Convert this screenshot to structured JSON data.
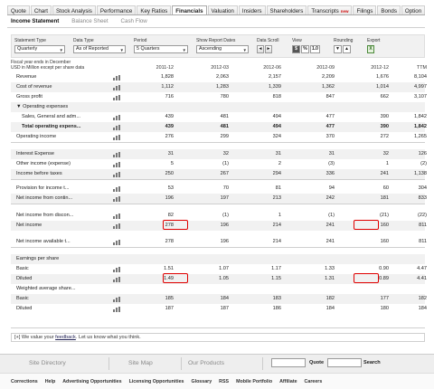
{
  "nav": {
    "tabs": [
      {
        "label": "Quote"
      },
      {
        "label": "Chart"
      },
      {
        "label": "Stock Analysis"
      },
      {
        "label": "Performance"
      },
      {
        "label": "Key Ratios"
      },
      {
        "label": "Financials"
      },
      {
        "label": "Valuation"
      },
      {
        "label": "Insiders"
      },
      {
        "label": "Shareholders"
      },
      {
        "label": "Transcripts",
        "badge": "new"
      },
      {
        "label": "Filings"
      },
      {
        "label": "Bonds"
      },
      {
        "label": "Option"
      }
    ],
    "active_tab": "Financials"
  },
  "subnav": {
    "items": [
      "Income Statement",
      "Balance Sheet",
      "Cash Flow"
    ],
    "active": "Income Statement"
  },
  "controls": {
    "statement_type": {
      "label": "Statement Type",
      "value": "Quarterly"
    },
    "data_type": {
      "label": "Data Type",
      "value": "As of Reported"
    },
    "period": {
      "label": "Period",
      "value": "5 Quarters"
    },
    "show_report_dates": {
      "label": "Show Report Dates",
      "value": "Ascending"
    },
    "data_scroll": {
      "label": "Data Scroll",
      "prev": "◄",
      "next": "►"
    },
    "view": {
      "label": "View",
      "buttons": [
        "$",
        "%",
        "1.0"
      ]
    },
    "rounding": {
      "label": "Rounding",
      "buttons": [
        "▼",
        "▲"
      ]
    },
    "export": {
      "label": "Export",
      "icon": "excel-export-icon"
    }
  },
  "fiscal_info": {
    "line1": "Fiscal year ends in December",
    "line2": "USD in Million except per share data"
  },
  "columns": [
    "2011-12",
    "2012-03",
    "2012-06",
    "2012-09",
    "2012-12",
    "TTM"
  ],
  "rows": [
    {
      "label": "Revenue",
      "values": [
        "1,828",
        "2,063",
        "2,157",
        "2,209",
        "1,676",
        "8,104"
      ],
      "icon": true,
      "shade": false
    },
    {
      "label": "Cost of revenue",
      "values": [
        "1,112",
        "1,283",
        "1,339",
        "1,362",
        "1,014",
        "4,997"
      ],
      "icon": true,
      "shade": true
    },
    {
      "label": "Gross profit",
      "values": [
        "716",
        "780",
        "818",
        "847",
        "662",
        "3,107"
      ],
      "icon": true,
      "shade": false
    },
    {
      "label": "▼ Operating expenses",
      "values": [
        "",
        "",
        "",
        "",
        "",
        ""
      ],
      "icon": false,
      "shade": true
    },
    {
      "label": "Sales, General and adm...",
      "values": [
        "439",
        "481",
        "494",
        "477",
        "390",
        "1,842"
      ],
      "icon": true,
      "shade": false,
      "indent": true
    },
    {
      "label": "Total operating expens...",
      "values": [
        "439",
        "481",
        "494",
        "477",
        "390",
        "1,842"
      ],
      "icon": true,
      "shade": true,
      "indent": true,
      "bold": true
    },
    {
      "label": "Operating income",
      "values": [
        "276",
        "299",
        "324",
        "370",
        "272",
        "1,265"
      ],
      "icon": true,
      "shade": false
    },
    {
      "label": "Interest Expense",
      "values": [
        "31",
        "32",
        "31",
        "31",
        "32",
        "126"
      ],
      "icon": true,
      "shade": true
    },
    {
      "label": "Other income (expense)",
      "values": [
        "5",
        "(1)",
        "2",
        "(3)",
        "1",
        "(2)"
      ],
      "icon": true,
      "shade": false
    },
    {
      "label": "Income before taxes",
      "values": [
        "250",
        "267",
        "294",
        "336",
        "241",
        "1,138"
      ],
      "icon": true,
      "shade": true
    },
    {
      "label": "Provision for income t...",
      "values": [
        "53",
        "70",
        "81",
        "94",
        "60",
        "304"
      ],
      "icon": true,
      "shade": false
    },
    {
      "label": "Net income from contin...",
      "values": [
        "196",
        "197",
        "213",
        "242",
        "181",
        "833"
      ],
      "icon": true,
      "shade": true
    },
    {
      "label": "Net income from discon...",
      "values": [
        "82",
        "(1)",
        "1",
        "(1)",
        "(21)",
        "(22)"
      ],
      "icon": true,
      "shade": false
    },
    {
      "label": "Net income",
      "values": [
        "278",
        "196",
        "214",
        "241",
        "160",
        "811"
      ],
      "icon": true,
      "shade": true
    },
    {
      "label": "Net income available t...",
      "values": [
        "278",
        "196",
        "214",
        "241",
        "160",
        "811"
      ],
      "icon": true,
      "shade": false
    },
    {
      "label": "Earnings per share",
      "values": [
        "",
        "",
        "",
        "",
        "",
        ""
      ],
      "icon": false,
      "shade": true
    },
    {
      "label": "Basic",
      "values": [
        "1.51",
        "1.07",
        "1.17",
        "1.33",
        "0.90",
        "4.47"
      ],
      "icon": true,
      "shade": false
    },
    {
      "label": "Diluted",
      "values": [
        "1.49",
        "1.05",
        "1.15",
        "1.31",
        "0.89",
        "4.41"
      ],
      "icon": true,
      "shade": true
    },
    {
      "label": "Weighted average share...",
      "values": [
        "",
        "",
        "",
        "",
        "",
        ""
      ],
      "icon": false,
      "shade": false
    },
    {
      "label": "Basic",
      "values": [
        "185",
        "184",
        "183",
        "182",
        "177",
        "182"
      ],
      "icon": true,
      "shade": true
    },
    {
      "label": "Diluted",
      "values": [
        "187",
        "187",
        "186",
        "184",
        "180",
        "184"
      ],
      "icon": true,
      "shade": false
    }
  ],
  "feedback": {
    "prefix": "[+] We value your ",
    "link": "feedback",
    "suffix": ". Let us know what you think."
  },
  "footer": {
    "items": [
      "Site Directory",
      "Site Map",
      "Our Products"
    ],
    "quote_button": "Quote",
    "search_button": "Search",
    "links": [
      "Corrections",
      "Help",
      "Advertising Opportunities",
      "Licensing Opportunities",
      "Glossary",
      "RSS",
      "Mobile Portfolio",
      "Affiliate",
      "Careers"
    ]
  },
  "highlight_color": "#e00000"
}
